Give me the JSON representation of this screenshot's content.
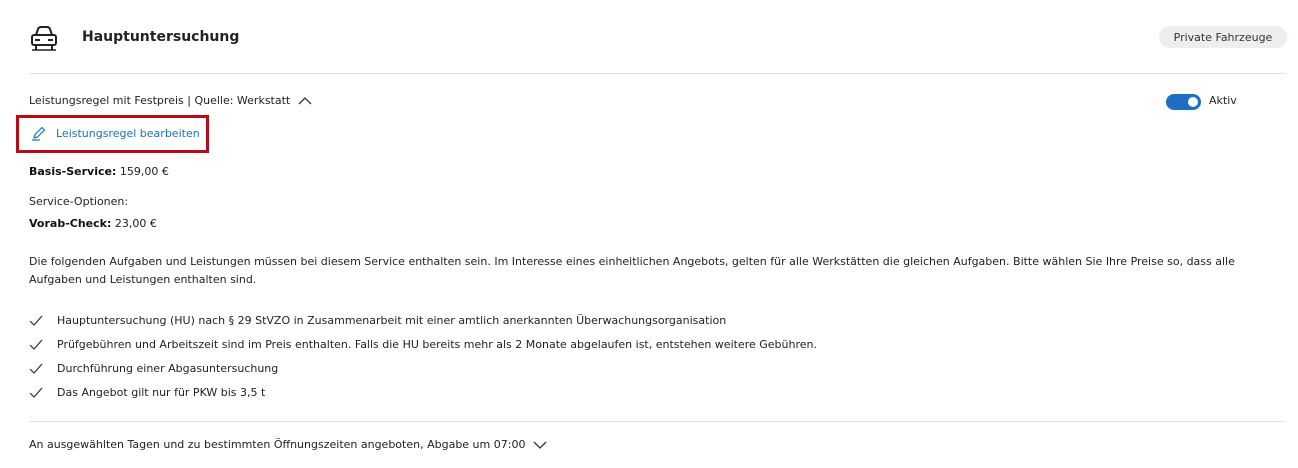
{
  "header": {
    "icon": "car-front-icon",
    "title": "Hauptuntersuchung",
    "badge": "Private Fahrzeuge"
  },
  "rule": {
    "summary": "Leistungsregel mit Festpreis | Quelle: Werkstatt",
    "expand_icon": "chevron-up-icon",
    "toggle_on": true,
    "toggle_label": "Aktiv",
    "edit_link": "Leistungsregel bearbeiten",
    "edit_icon": "pencil-icon",
    "highlight_color": "#b50c16"
  },
  "pricing": {
    "basis_label": "Basis-Service:",
    "basis_value": "159,00 €",
    "options_label": "Service-Optionen:",
    "vorab_label": "Vorab-Check:",
    "vorab_value": "23,00 €"
  },
  "description": "Die folgenden Aufgaben und Leistungen müssen bei diesem Service enthalten sein. Im Interesse eines einheitlichen Angebots, gelten für alle Werkstätten die gleichen Aufgaben. Bitte wählen Sie Ihre Preise so, dass alle Aufgaben und Leistungen enthalten sind.",
  "checklist": [
    "Hauptuntersuchung (HU) nach § 29 StVZO in Zusammenarbeit mit einer amtlich anerkannten Überwachungsorganisation",
    "Prüfgebühren und Arbeitszeit sind im Preis enthalten. Falls die HU bereits mehr als 2 Monate abgelaufen ist, entstehen weitere Gebühren.",
    "Durchführung einer Abgasuntersuchung",
    "Das Angebot gilt nur für PKW bis 3,5 t"
  ],
  "availability": {
    "text": "An ausgewählten Tagen und zu bestimmten Öffnungszeiten angeboten, Abgabe um 07:00",
    "expand_icon": "chevron-down-icon"
  },
  "colors": {
    "accent": "#1e6fc4",
    "link": "#1a73b8"
  }
}
